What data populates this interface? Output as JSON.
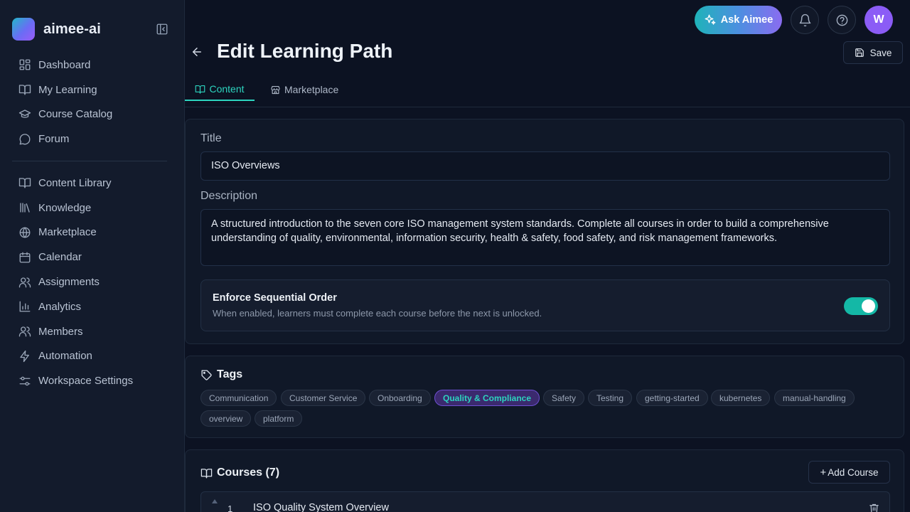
{
  "brand": {
    "name": "aimee-ai"
  },
  "sidebar": {
    "primary": [
      {
        "label": "Dashboard",
        "icon": "dashboard-icon"
      },
      {
        "label": "My Learning",
        "icon": "book-open-icon"
      },
      {
        "label": "Course Catalog",
        "icon": "graduation-cap-icon"
      },
      {
        "label": "Forum",
        "icon": "chat-bubble-icon"
      }
    ],
    "secondary": [
      {
        "label": "Content Library",
        "icon": "book-open-icon"
      },
      {
        "label": "Knowledge",
        "icon": "library-icon"
      },
      {
        "label": "Marketplace",
        "icon": "globe-icon"
      },
      {
        "label": "Calendar",
        "icon": "calendar-icon"
      },
      {
        "label": "Assignments",
        "icon": "users-icon"
      },
      {
        "label": "Analytics",
        "icon": "bar-chart-icon"
      },
      {
        "label": "Members",
        "icon": "users-icon"
      },
      {
        "label": "Automation",
        "icon": "lightning-icon"
      },
      {
        "label": "Workspace Settings",
        "icon": "sliders-icon"
      }
    ]
  },
  "topbar": {
    "ask_label": "Ask Aimee",
    "avatar_initial": "W"
  },
  "header": {
    "title": "Edit Learning Path",
    "save_label": "Save"
  },
  "tabs": [
    {
      "label": "Content",
      "active": true
    },
    {
      "label": "Marketplace",
      "active": false
    }
  ],
  "form": {
    "title_label": "Title",
    "title_value": "ISO Overviews",
    "description_label": "Description",
    "description_value": "A structured introduction to the seven core ISO management system standards. Complete all courses in order to build a comprehensive understanding of quality, environmental, information security, health & safety, food safety, and risk management frameworks.",
    "sequential_title": "Enforce Sequential Order",
    "sequential_desc": "When enabled, learners must complete each course before the next is unlocked.",
    "sequential_enabled": true
  },
  "tags": {
    "heading": "Tags",
    "items": [
      {
        "label": "Communication",
        "selected": false
      },
      {
        "label": "Customer Service",
        "selected": false
      },
      {
        "label": "Onboarding",
        "selected": false
      },
      {
        "label": "Quality & Compliance",
        "selected": true
      },
      {
        "label": "Safety",
        "selected": false
      },
      {
        "label": "Testing",
        "selected": false
      },
      {
        "label": "getting-started",
        "selected": false
      },
      {
        "label": "kubernetes",
        "selected": false
      },
      {
        "label": "manual-handling",
        "selected": false
      },
      {
        "label": "overview",
        "selected": false
      },
      {
        "label": "platform",
        "selected": false
      }
    ]
  },
  "courses": {
    "heading": "Courses (7)",
    "add_label": "Add Course",
    "items": [
      {
        "number": "1",
        "title": "ISO Quality System Overview"
      }
    ]
  },
  "colors": {
    "accent": "#2dd4bf",
    "toggle_on": "#14b8a6",
    "avatar": "#8b5cf6",
    "selected_tag_bg": "#3b2a6e"
  }
}
